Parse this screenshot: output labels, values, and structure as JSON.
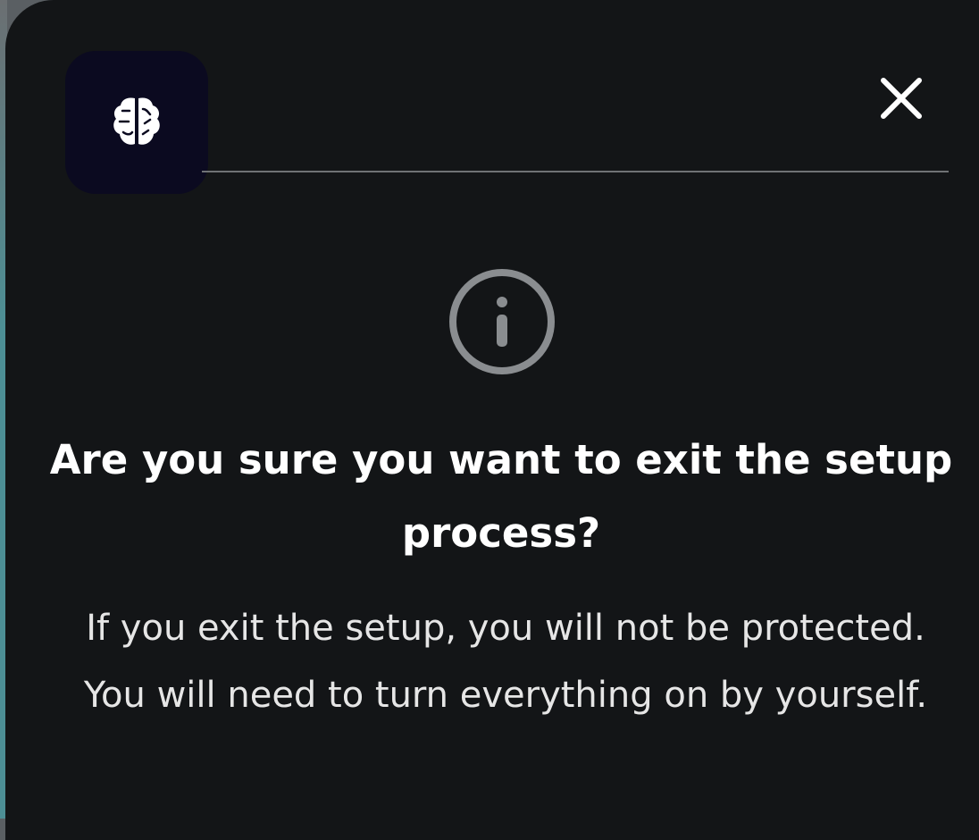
{
  "dialog": {
    "logo_icon": "brain-icon",
    "close_icon": "close-icon",
    "status_icon": "info-icon",
    "title": "Are you sure you want to exit the setup process?",
    "message": "If you exit the setup, you will not be protected. You will need to turn everything on by yourself.",
    "colors": {
      "background": "#131517",
      "logo_background": "#0b0a20",
      "icon_ring": "#8a8d90"
    }
  }
}
